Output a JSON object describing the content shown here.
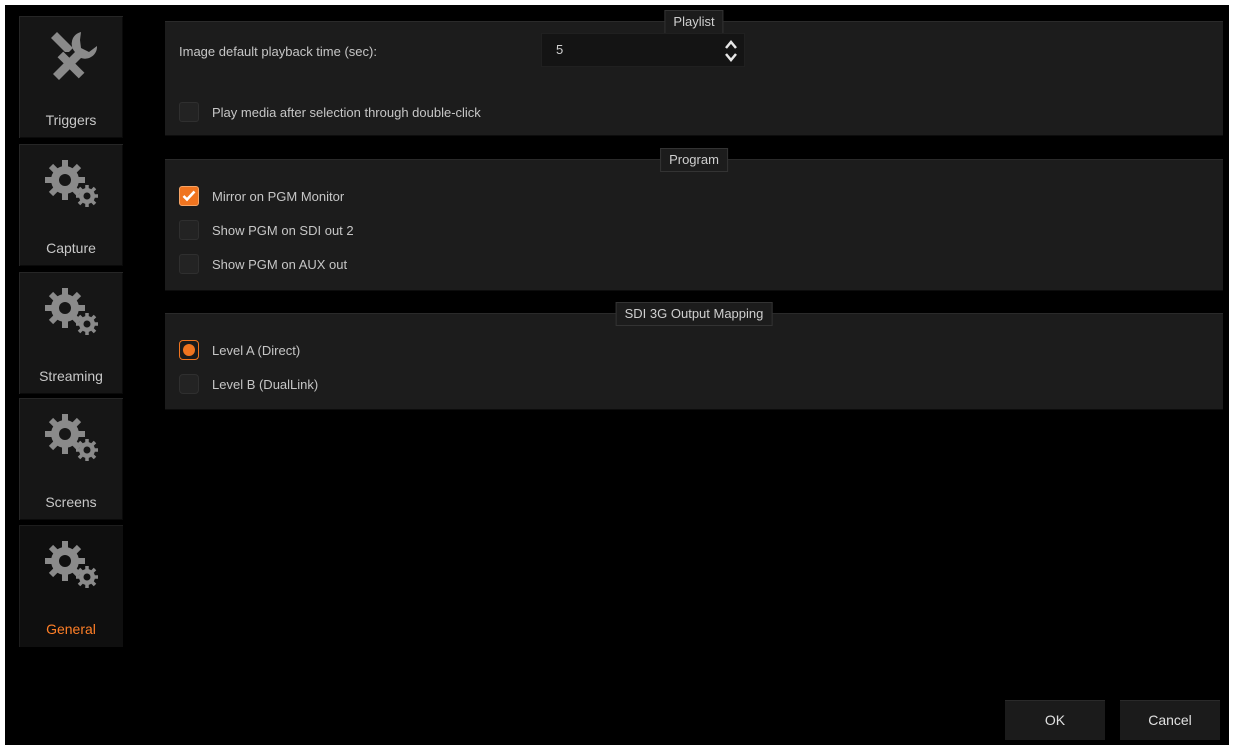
{
  "sidebar": {
    "items": [
      {
        "label": "Triggers",
        "icon": "tools-icon",
        "active": false
      },
      {
        "label": "Capture",
        "icon": "gears-icon",
        "active": false
      },
      {
        "label": "Streaming",
        "icon": "gears-icon",
        "active": false
      },
      {
        "label": "Screens",
        "icon": "gears-icon",
        "active": false
      },
      {
        "label": "General",
        "icon": "gears-icon",
        "active": true
      }
    ]
  },
  "playlist": {
    "title": "Playlist",
    "playback_time_label": "Image default playback time (sec):",
    "playback_time_value": "5",
    "play_on_doubleclick_label": "Play media after selection through double-click",
    "play_on_doubleclick_checked": false
  },
  "program": {
    "title": "Program",
    "options": [
      {
        "label": "Mirror on PGM Monitor",
        "checked": true
      },
      {
        "label": "Show PGM on SDI out 2",
        "checked": false
      },
      {
        "label": "Show PGM on AUX out",
        "checked": false
      }
    ]
  },
  "sdi_mapping": {
    "title": "SDI 3G Output Mapping",
    "options": [
      {
        "label": "Level A (Direct)",
        "selected": true
      },
      {
        "label": "Level B (DualLink)",
        "selected": false
      }
    ]
  },
  "footer": {
    "ok_label": "OK",
    "cancel_label": "Cancel"
  },
  "colors": {
    "accent": "#f0741f",
    "background": "#000000",
    "panel": "#1c1c1c",
    "sidebar_tile": "#161616"
  }
}
